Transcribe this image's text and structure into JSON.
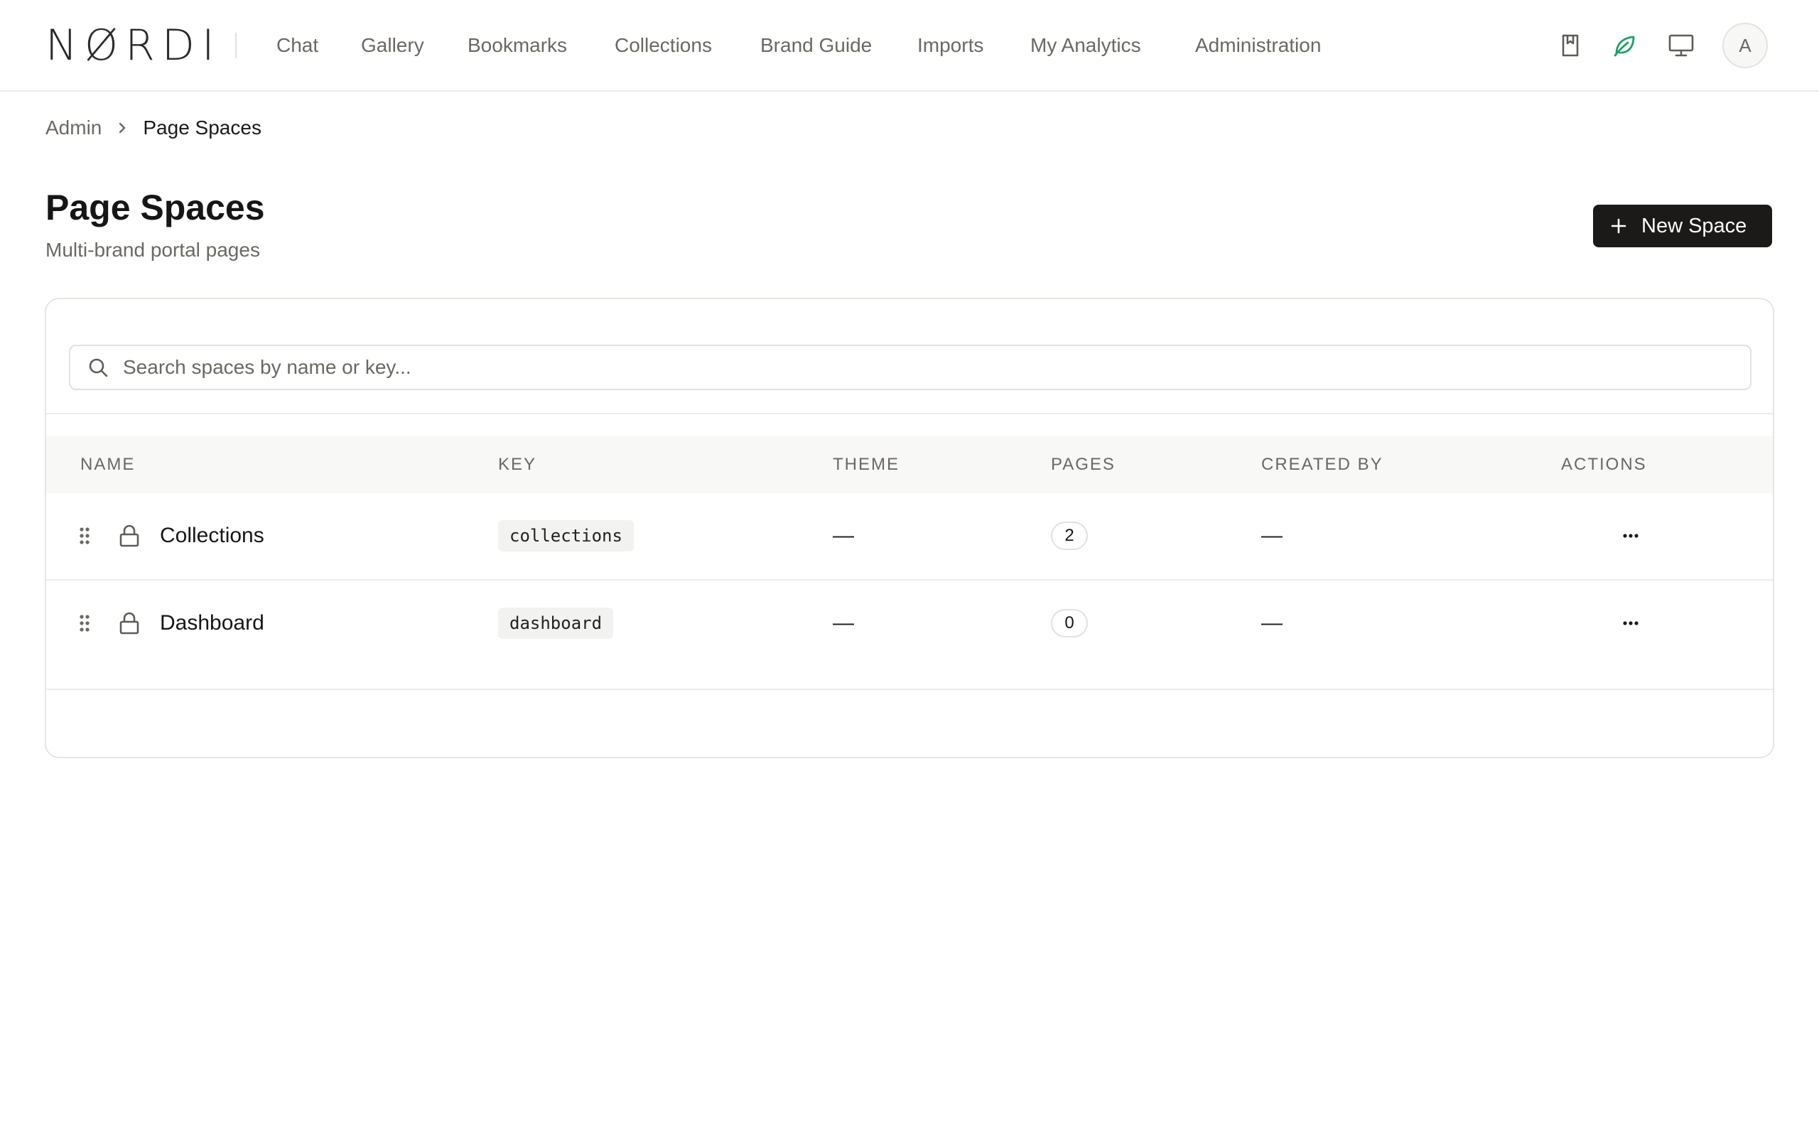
{
  "header": {
    "logo": "NØRDI",
    "nav": [
      {
        "label": "Chat"
      },
      {
        "label": "Gallery"
      },
      {
        "label": "Bookmarks"
      },
      {
        "label": "Collections"
      },
      {
        "label": "Brand Guide"
      },
      {
        "label": "Imports"
      },
      {
        "label": "My Analytics"
      },
      {
        "label": "Administration"
      }
    ],
    "icons": [
      "bookmark-icon",
      "leaf-icon",
      "monitor-icon"
    ],
    "accent_color": "#1f9e6a",
    "avatar_initial": "A"
  },
  "breadcrumb": {
    "parent": "Admin",
    "current": "Page Spaces"
  },
  "page": {
    "title": "Page Spaces",
    "subtitle": "Multi-brand portal pages",
    "new_button_label": "New Space"
  },
  "search": {
    "placeholder": "Search spaces by name or key...",
    "value": ""
  },
  "table": {
    "columns": [
      "NAME",
      "KEY",
      "THEME",
      "PAGES",
      "CREATED BY",
      "ACTIONS"
    ],
    "rows": [
      {
        "name": "Collections",
        "key": "collections",
        "theme": "—",
        "pages": "2",
        "created_by": "—",
        "actions": "···"
      },
      {
        "name": "Dashboard",
        "key": "dashboard",
        "theme": "—",
        "pages": "0",
        "created_by": "—",
        "actions": "···"
      }
    ]
  }
}
